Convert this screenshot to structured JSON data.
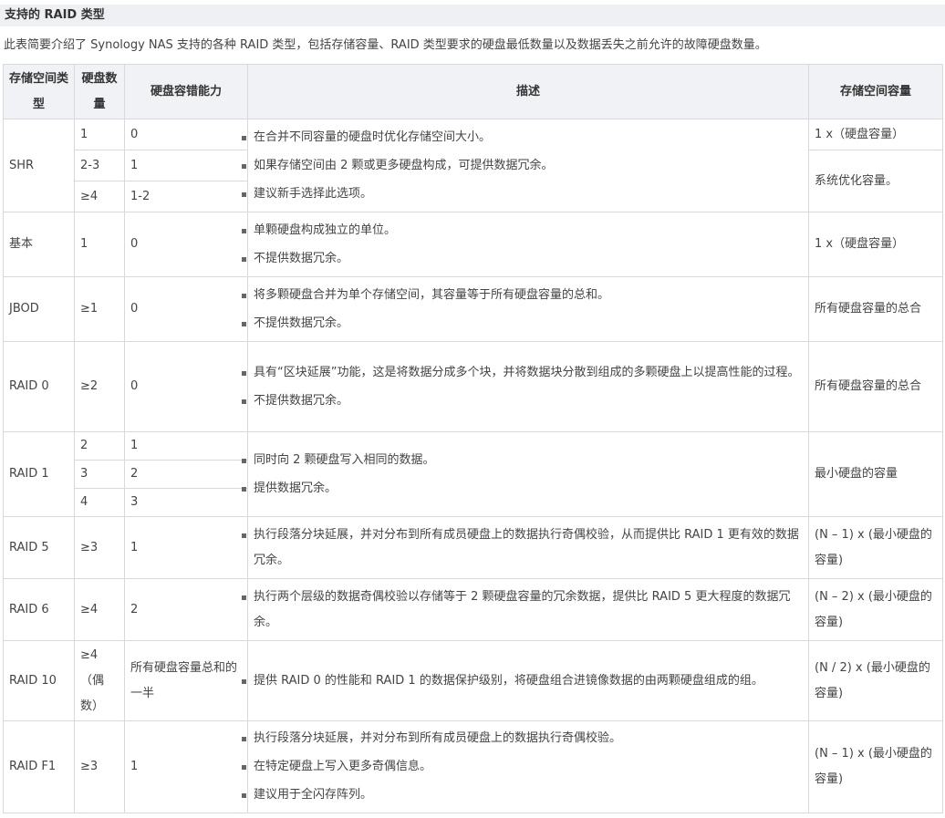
{
  "title": "支持的 RAID 类型",
  "intro": "此表简要介绍了 Synology NAS 支持的各种 RAID 类型，包括存储容量、RAID 类型要求的硬盘最低数量以及数据丢失之前允许的故障硬盘数量。",
  "headers": {
    "type": "存储空间类型",
    "disks": "硬盘数量",
    "tolerance": "硬盘容错能力",
    "description": "描述",
    "capacity": "存储空间容量"
  },
  "rows": {
    "shr": {
      "type": "SHR",
      "sub": [
        {
          "disks": "1",
          "tolerance": "0"
        },
        {
          "disks": "2-3",
          "tolerance": "1"
        },
        {
          "disks": "≥4",
          "tolerance": "1-2"
        }
      ],
      "desc": [
        "在合并不同容量的硬盘时优化存储空间大小。",
        "如果存储空间由 2 颗或更多硬盘构成，可提供数据冗余。",
        "建议新手选择此选项。"
      ],
      "capacity_1": "1 x（硬盘容量）",
      "capacity_2": "系统优化容量。"
    },
    "basic": {
      "type": "基本",
      "disks": "1",
      "tolerance": "0",
      "desc": [
        "单颗硬盘构成独立的单位。",
        "不提供数据冗余。"
      ],
      "capacity": "1 x（硬盘容量）"
    },
    "jbod": {
      "type": "JBOD",
      "disks": "≥1",
      "tolerance": "0",
      "desc": [
        "将多颗硬盘合并为单个存储空间，其容量等于所有硬盘容量的总和。",
        "不提供数据冗余。"
      ],
      "capacity": "所有硬盘容量的总合"
    },
    "raid0": {
      "type": "RAID 0",
      "disks": "≥2",
      "tolerance": "0",
      "desc": [
        "具有“区块延展”功能，这是将数据分成多个块，并将数据块分散到组成的多颗硬盘上以提高性能的过程。",
        "不提供数据冗余。"
      ],
      "capacity": "所有硬盘容量的总合"
    },
    "raid1": {
      "type": "RAID 1",
      "sub": [
        {
          "disks": "2",
          "tolerance": "1"
        },
        {
          "disks": "3",
          "tolerance": "2"
        },
        {
          "disks": "4",
          "tolerance": "3"
        }
      ],
      "desc": [
        "同时向 2 颗硬盘写入相同的数据。",
        "提供数据冗余。"
      ],
      "capacity": "最小硬盘的容量"
    },
    "raid5": {
      "type": "RAID 5",
      "disks": "≥3",
      "tolerance": "1",
      "desc": [
        "执行段落分块延展，并对分布到所有成员硬盘上的数据执行奇偶校验，从而提供比 RAID 1 更有效的数据冗余。"
      ],
      "capacity": "(N – 1) x (最小硬盘的容量)"
    },
    "raid6": {
      "type": "RAID 6",
      "disks": "≥4",
      "tolerance": "2",
      "desc": [
        "执行两个层级的数据奇偶校验以存储等于 2 颗硬盘容量的冗余数据，提供比 RAID 5 更大程度的数据冗余。"
      ],
      "capacity": "(N – 2) x (最小硬盘的容量)"
    },
    "raid10": {
      "type": "RAID 10",
      "disks": "≥4 （偶数）",
      "tolerance": "所有硬盘容量总和的一半",
      "desc": [
        "提供 RAID 0 的性能和 RAID 1 的数据保护级别，将硬盘组合进镜像数据的由两颗硬盘组成的组。"
      ],
      "capacity": "(N / 2) x (最小硬盘的容量)"
    },
    "raidf1": {
      "type": "RAID F1",
      "disks": "≥3",
      "tolerance": "1",
      "desc": [
        "执行段落分块延展，并对分布到所有成员硬盘上的数据执行奇偶校验。",
        "在特定硬盘上写入更多奇偶信息。",
        "建议用于全闪存阵列。"
      ],
      "capacity": "(N – 1) x (最小硬盘的容量)"
    }
  }
}
